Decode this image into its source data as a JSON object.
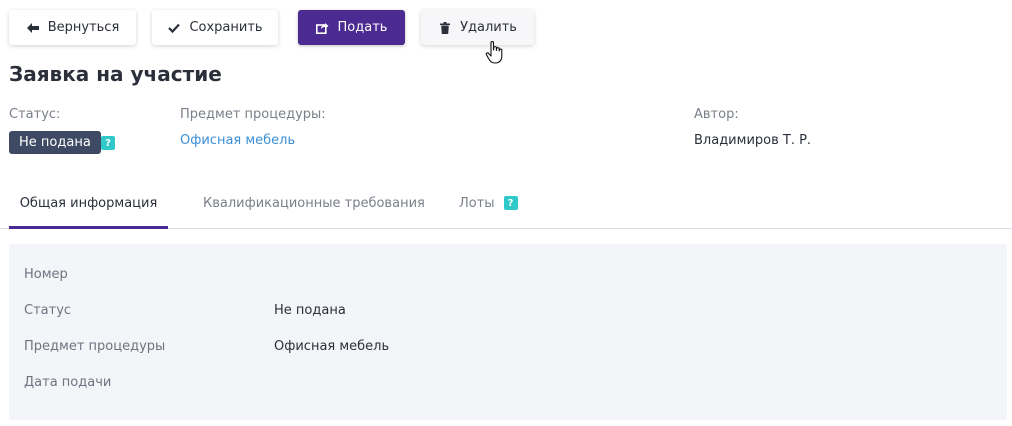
{
  "toolbar": {
    "back_label": "Вернуться",
    "save_label": "Сохранить",
    "submit_label": "Подать",
    "delete_label": "Удалить"
  },
  "page": {
    "title": "Заявка на участие"
  },
  "meta": {
    "status_label": "Статус:",
    "status_value": "Не подана",
    "subject_label": "Предмет процедуры:",
    "subject_value": "Офисная мебель",
    "author_label": "Автор:",
    "author_value": "Владимиров Т. Р.",
    "help_glyph": "?"
  },
  "tabs": [
    {
      "label": "Общая информация",
      "active": true
    },
    {
      "label": "Квалификационные требования",
      "active": false
    },
    {
      "label": "Лоты",
      "active": false
    }
  ],
  "details": {
    "rows": [
      {
        "label": "Номер",
        "value": ""
      },
      {
        "label": "Статус",
        "value": "Не подана"
      },
      {
        "label": "Предмет процедуры",
        "value": "Офисная мебель"
      },
      {
        "label": "Дата подачи",
        "value": ""
      }
    ]
  },
  "colors": {
    "accent": "#4b2a91",
    "badge": "#3e4a63",
    "link": "#3d8fd6",
    "help": "#2ec9c8",
    "panel": "#f4f5f9"
  },
  "icons": {
    "back": "arrow-left-icon",
    "save": "check-icon",
    "submit": "share-icon",
    "delete": "trash-icon",
    "cursor": "hand-pointer-icon"
  }
}
